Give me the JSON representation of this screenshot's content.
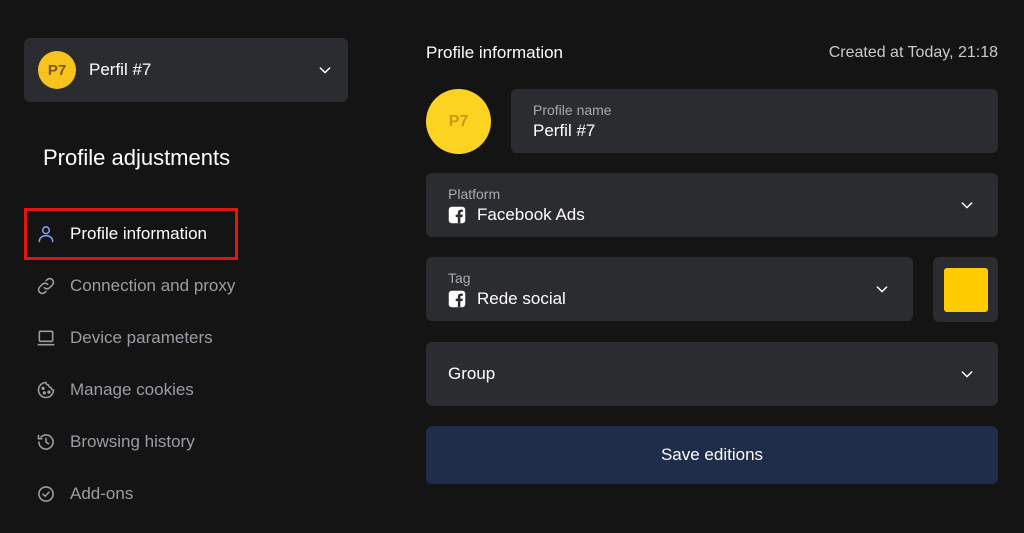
{
  "profile_selector": {
    "initials": "P7",
    "name": "Perfil #7"
  },
  "sidebar": {
    "title": "Profile adjustments",
    "items": [
      {
        "label": "Profile information",
        "icon": "user-icon",
        "active": true
      },
      {
        "label": "Connection and proxy",
        "icon": "link-icon"
      },
      {
        "label": "Device parameters",
        "icon": "laptop-icon"
      },
      {
        "label": "Manage cookies",
        "icon": "cookie-icon"
      },
      {
        "label": "Browsing history",
        "icon": "history-icon"
      },
      {
        "label": "Add-ons",
        "icon": "check-circle-icon"
      }
    ]
  },
  "main": {
    "title": "Profile information",
    "created_at": "Created at Today, 21:18",
    "avatar_initials": "P7",
    "profile_name": {
      "label": "Profile name",
      "value": "Perfil #7"
    },
    "platform": {
      "label": "Platform",
      "value": "Facebook Ads",
      "icon": "facebook-icon"
    },
    "tag": {
      "label": "Tag",
      "value": "Rede social",
      "icon": "facebook-icon",
      "color": "#ffcc00"
    },
    "group": {
      "label": "Group"
    },
    "save_label": "Save editions"
  },
  "colors": {
    "accent_yellow": "#fcd320",
    "save_button": "#1f2d4a",
    "highlight": "#e31414"
  }
}
